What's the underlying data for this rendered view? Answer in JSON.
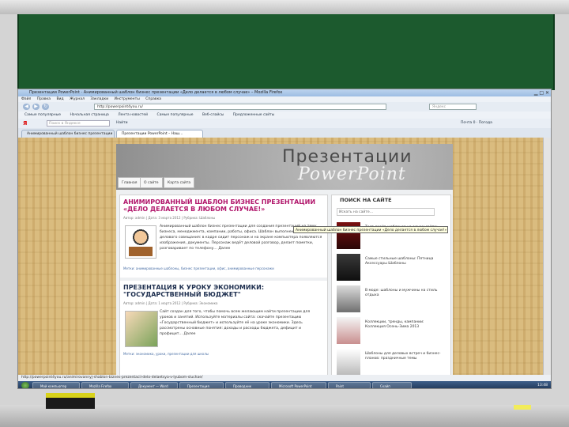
{
  "window": {
    "title": "Презентации PowerPoint · Анимированный шаблон бизнес презентации «Дело делается в любом случае» – Mozilla Firefox"
  },
  "menubar": [
    "Файл",
    "Правка",
    "Вид",
    "Журнал",
    "Закладки",
    "Инструменты",
    "Справка"
  ],
  "navbar": {
    "url": "http://powerpoint4you.ru/",
    "search_placeholder": "Яндекс",
    "back_label": "◀",
    "forward_label": "▶",
    "reload_label": "↻"
  },
  "bookmarks": [
    "Самые популярные",
    "Начальная страница",
    "Лента новостей",
    "Самые популярные",
    "Веб-слайсы",
    "Предложенные сайты"
  ],
  "yandex_bar": {
    "input_placeholder": "Поиск в Яндексе",
    "search_label": "Найти",
    "right_info": "Почта 0 · Погода"
  },
  "tabs": [
    {
      "label": "Анимированный шаблон бизнес презентации «Дело…»"
    },
    {
      "label": "Презентации PowerPoint – Наш…"
    }
  ],
  "site": {
    "banner_line1": "Презентации",
    "banner_line2": "PowerPoint",
    "nav": [
      "Главная",
      "О сайте",
      "Карта сайта"
    ]
  },
  "articles": [
    {
      "title": "АНИМИРОВАННЫЙ ШАБЛОН БИЗНЕС ПРЕЗЕНТАЦИИ «ДЕЛО ДЕЛАЕТСЯ В ЛЮБОМ СЛУЧАЕ!»",
      "meta": "Автор: admin | Дата: 3 марта 2012 | Рубрика: Шаблоны",
      "text": "Анимированный шаблон бизнес презентации для создания презентаций на тему бизнеса, менеджмента, компании, работы, офиса. Шаблон выполнен в стиле делового совещания: в кадре сидит персонаж и на экране компьютера появляются изображения, документы. Персонаж ведёт деловой разговор, делает пометки, разговаривает по телефону… Далее",
      "tags": "Метки: анимированные шаблоны, бизнес презентации, офис, анимированные персонажи"
    },
    {
      "title": "ПРЕЗЕНТАЦИЯ К УРОКУ ЭКОНОМИКИ: \"ГОСУДАРСТВЕННЫЙ БЮДЖЕТ\"",
      "meta": "Автор: admin | Дата: 1 марта 2012 | Рубрика: Экономика",
      "text": "Сайт создан для того, чтобы помочь всем желающим найти презентации для уроков и занятий. Используйте материалы сайта: скачайте презентацию «Государственный бюджет» и используйте её на уроке экономики. Здесь рассмотрены основные понятия: доходы и расходы бюджета, дефицит и профицит… Далее",
      "tags": "Метки: экономика, уроки, презентации для школы"
    }
  ],
  "sidebar": {
    "heading": "ПОИСК НА САЙТЕ",
    "search_value": "Искать на сайте…",
    "items": [
      "Тест-драйв шаблонов на одном сайте: Мы Бесплатные шаблоны",
      "Самые стильные шаблоны: Пятница Аксессуары Шаблоны",
      "В моде: шаблоны и мужчины на стиль отдыха",
      "Коллекции, тренды, кампании: Коллекция Осень-Зима 2013",
      "Шаблоны для деловых встреч и бизнес-планов: праздничные темы"
    ]
  },
  "tooltip": "Анимированный шаблон бизнес презентации «Дело делается в любом случае!»",
  "statusbar": "http://powerpoint4you.ru/animirovannyj-shablon-biznes-prezentacii-delo-delaetsya-v-lyubom-sluchae/",
  "taskbar": {
    "tasks": [
      "Мой компьютер",
      "Mozilla Firefox",
      "Документ — Word",
      "Презентация",
      "Проводник",
      "Microsoft PowerPoint",
      "Paint",
      "Скайп"
    ],
    "clock": "13:48"
  }
}
